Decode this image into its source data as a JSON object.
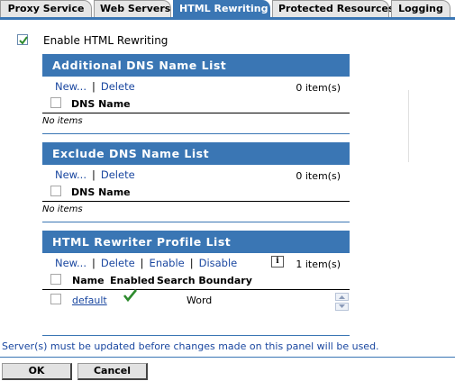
{
  "tabs": [
    {
      "label": "Proxy Service"
    },
    {
      "label": "Web Servers"
    },
    {
      "label": "HTML Rewriting"
    },
    {
      "label": "Protected Resources"
    },
    {
      "label": "Logging"
    }
  ],
  "enable": {
    "label": "Enable HTML Rewriting",
    "checked": true
  },
  "additional_dns": {
    "title": "Additional DNS Name List",
    "new_label": "New...",
    "delete_label": "Delete",
    "count": "0 item(s)",
    "column": "DNS Name",
    "empty": "No items"
  },
  "exclude_dns": {
    "title": "Exclude DNS Name List",
    "new_label": "New...",
    "delete_label": "Delete",
    "count": "0 item(s)",
    "column": "DNS Name",
    "empty": "No items"
  },
  "profiles": {
    "title": "HTML Rewriter Profile List",
    "new_label": "New...",
    "delete_label": "Delete",
    "enable_label": "Enable",
    "disable_label": "Disable",
    "count": "1 item(s)",
    "columns": {
      "name": "Name",
      "enabled": "Enabled",
      "boundary": "Search Boundary"
    },
    "rows": [
      {
        "name": "default",
        "enabled": true,
        "boundary": "Word"
      }
    ]
  },
  "footer": {
    "message": "Server(s) must be updated before changes made on this panel will be used.",
    "ok_label": "OK",
    "cancel_label": "Cancel"
  },
  "colors": {
    "accent": "#3a76b4",
    "link": "#1a47a0",
    "check": "#2e8b2e"
  },
  "icons": [
    "checkmark-icon",
    "info-icon",
    "scroll-up-icon",
    "scroll-down-icon"
  ]
}
